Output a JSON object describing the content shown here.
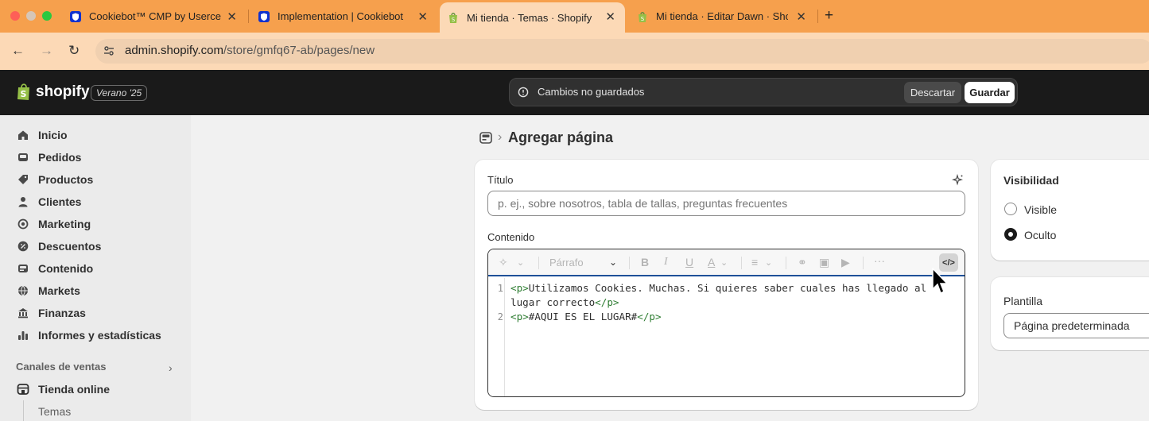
{
  "browser": {
    "tabs": [
      {
        "title": "Cookiebot™ CMP by Usercentrics",
        "icon": "cookiebot-shield-icon"
      },
      {
        "title": "Implementation | Cookiebot",
        "icon": "cookiebot-shield-icon"
      },
      {
        "title": "Mi tienda · Temas · Shopify",
        "icon": "shopify-bag-icon",
        "active": true
      },
      {
        "title": "Mi tienda · Editar Dawn · Shopify",
        "icon": "shopify-bag-icon"
      }
    ],
    "url_host": "admin.shopify.com",
    "url_path": "/store/gmfq67-ab/pages/new"
  },
  "topbar": {
    "brand": "shopify",
    "edition": "Verano '25",
    "unsaved_text": "Cambios no guardados",
    "discard_label": "Descartar",
    "save_label": "Guardar"
  },
  "sidebar": {
    "items": [
      {
        "label": "Inicio",
        "icon": "home-icon"
      },
      {
        "label": "Pedidos",
        "icon": "orders-icon"
      },
      {
        "label": "Productos",
        "icon": "tag-icon"
      },
      {
        "label": "Clientes",
        "icon": "person-icon"
      },
      {
        "label": "Marketing",
        "icon": "target-icon"
      },
      {
        "label": "Descuentos",
        "icon": "discount-icon"
      },
      {
        "label": "Contenido",
        "icon": "content-icon"
      },
      {
        "label": "Markets",
        "icon": "globe-icon"
      },
      {
        "label": "Finanzas",
        "icon": "bank-icon"
      },
      {
        "label": "Informes y estadísticas",
        "icon": "bar-chart-icon"
      }
    ],
    "section_label": "Canales de ventas",
    "channel_label": "Tienda online",
    "sub_item": "Temas"
  },
  "page": {
    "title": "Agregar página",
    "title_label": "Título",
    "title_placeholder": "p. ej., sobre nosotros, tabla de tallas, preguntas frecuentes",
    "content_label": "Contenido",
    "paragraph_select": "Párrafo",
    "code": {
      "line1_num": "1",
      "line1_open": "<p>",
      "line1_text": "Utilizamos Cookies. Muchas. Si quieres saber cuales has llegado al",
      "line1b_text": "lugar correcto",
      "line1_close": "</p>",
      "line2_num": "2",
      "line2_open": "<p>",
      "line2_text": "#AQUI ES EL LUGAR#",
      "line2_close": "</p>"
    }
  },
  "visibility": {
    "heading": "Visibilidad",
    "options": [
      {
        "label": "Visible",
        "selected": false
      },
      {
        "label": "Oculto",
        "selected": true
      }
    ]
  },
  "template": {
    "label": "Plantilla",
    "value": "Página predeterminada"
  },
  "colors": {
    "tab_bar": "#f6a04d",
    "address_bar": "#fcd9b6",
    "shopify_dark": "#1a1a1a",
    "editor_focus": "#1f5199",
    "code_tag": "#2e7d32"
  }
}
